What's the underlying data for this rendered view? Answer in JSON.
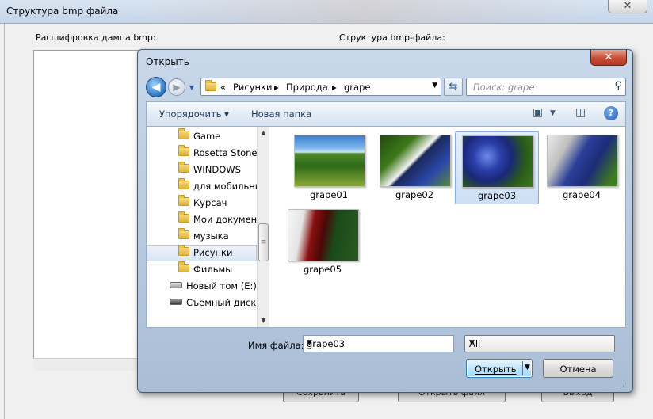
{
  "background": {
    "title": "Структура bmp файла",
    "left_label": "Расшифровка дампа bmp:",
    "right_label": "Структура bmp-файла:",
    "close_glyph": "✕",
    "buttons": [
      "Сохранить",
      "Открыть файл",
      "Выход"
    ]
  },
  "dialog": {
    "title": "Открыть",
    "close_glyph": "✕",
    "address": {
      "prefix": "«",
      "segments": [
        "Рисунки",
        "Природа",
        "grape"
      ],
      "sep": "▸"
    },
    "search_placeholder": "Поиск: grape",
    "toolbar": {
      "organize": "Упорядочить ▾",
      "new_folder": "Новая папка"
    },
    "tree": [
      {
        "label": "Game",
        "type": "folder"
      },
      {
        "label": "Rosetta Stone",
        "type": "folder"
      },
      {
        "label": "WINDOWS",
        "type": "folder"
      },
      {
        "label": "для мобильни",
        "type": "folder"
      },
      {
        "label": "Курсач",
        "type": "folder"
      },
      {
        "label": "Мои документ",
        "type": "folder"
      },
      {
        "label": "музыка",
        "type": "folder"
      },
      {
        "label": "Рисунки",
        "type": "folder",
        "selected": true
      },
      {
        "label": "Фильмы",
        "type": "folder"
      },
      {
        "label": "Новый том (E:)",
        "type": "drive"
      },
      {
        "label": "Съемный диск (",
        "type": "drive"
      }
    ],
    "files": [
      {
        "name": "grape01",
        "cls": "g01"
      },
      {
        "name": "grape02",
        "cls": "g02"
      },
      {
        "name": "grape03",
        "cls": "g03",
        "selected": true
      },
      {
        "name": "grape04",
        "cls": "g04"
      },
      {
        "name": "grape05",
        "cls": "g05"
      }
    ],
    "filename_label": "Имя файла:",
    "filename_value": "grape03",
    "filter_value": "All",
    "open_label": "Открыть",
    "cancel_label": "Отмена"
  }
}
